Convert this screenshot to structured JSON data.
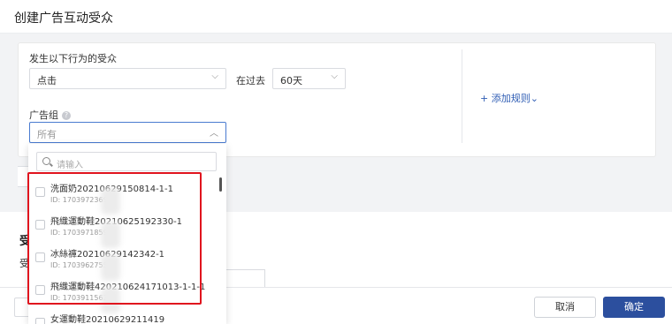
{
  "header": {
    "title": "创建广告互动受众"
  },
  "rule": {
    "behavior_label": "发生以下行为的受众",
    "action_select": "点击",
    "past_label": "在过去",
    "days_select": "60天",
    "add_rule": "+ 添加规则",
    "adgroup_label": "广告组",
    "adgroup_placeholder": "所有"
  },
  "dropdown": {
    "search_placeholder": "请输入",
    "items": [
      {
        "name": "洗面奶20210629150814-1-1",
        "id": "ID: 17039723699"
      },
      {
        "name": "飛織運動鞋20210625192330-1",
        "id": "ID: 17039718599"
      },
      {
        "name": "冰絲褲20210629142342-1",
        "id": "ID: 17039627559"
      },
      {
        "name": "飛織運動鞋420210624171013-1-1-1",
        "id": "ID: 17039115623"
      },
      {
        "name": "女運動鞋20210629211419",
        "id": ""
      }
    ]
  },
  "section2": {
    "title": "受",
    "sub": "受"
  },
  "footer": {
    "cancel": "取消",
    "confirm": "确定"
  },
  "colors": {
    "primary": "#2c4f9e",
    "link": "#2f5db4",
    "highlight": "#e0141e"
  }
}
